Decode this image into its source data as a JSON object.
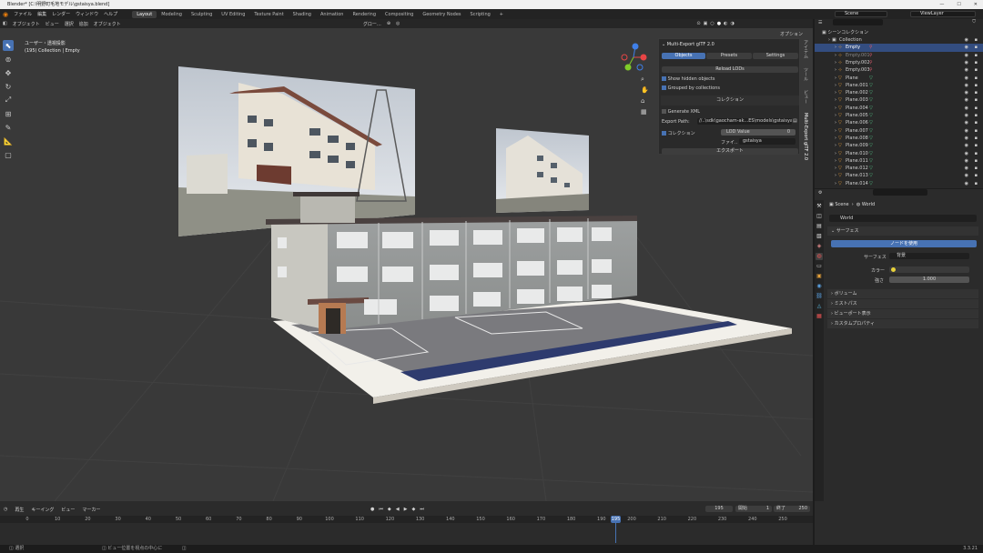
{
  "window": {
    "title": "Blender* [C:\\明野町毛地モデル\\gstaisya.blend]",
    "controls": [
      "—",
      "☐",
      "✕"
    ]
  },
  "topbar": {
    "menus": [
      "ファイル",
      "編集",
      "レンダー",
      "ウィンドウ",
      "ヘルプ"
    ],
    "workspaces": [
      "Layout",
      "Modeling",
      "Sculpting",
      "UV Editing",
      "Texture Paint",
      "Shading",
      "Animation",
      "Rendering",
      "Compositing",
      "Geometry Nodes",
      "Scripting"
    ],
    "active_workspace": "Layout",
    "scene": "Scene",
    "view_layer": "ViewLayer"
  },
  "viewport_header": {
    "items": [
      "オブジェクト",
      "ビュー",
      "選択",
      "追加",
      "オブジェクト"
    ],
    "orientation": "グロー…",
    "options_label": "オプション"
  },
  "viewport_info": {
    "line1": "ユーザー・透視投影",
    "line2": "(195) Collection | Empty"
  },
  "gizmo": {
    "x": "X",
    "y": "Y",
    "z": "Z"
  },
  "npanel": {
    "title": "Multi-Export glTF 2.0",
    "tabs": [
      "Objects",
      "Presets",
      "Settings"
    ],
    "active_tab": "Objects",
    "reload": "Reload LODs",
    "show_hidden": "Show hidden objects",
    "grouped": "Grouped by collections",
    "collection_section": "コレクション",
    "generate_xml": "Generate XML",
    "export_path_label": "Export Path:",
    "export_path": "//..\\sdk\\gaocham-ak...ES\\models\\gstaisyat",
    "collection_label": "コレクション",
    "lod_value": "LOD Value",
    "lod_num": "0",
    "file_label": "ファイ..",
    "file_value": "gstaisya",
    "export_button": "エクスポート"
  },
  "npanel_tabs": [
    "アイテム",
    "ツール",
    "ビュー",
    "Multi-Export glTF 2.0"
  ],
  "outliner": {
    "header_label": "シーンコレクション",
    "rows": [
      {
        "name": "Collection",
        "kind": "collection",
        "indent": 1,
        "selected": false
      },
      {
        "name": "Empty",
        "kind": "empty",
        "indent": 2,
        "selected": true
      },
      {
        "name": "Empty.001",
        "kind": "empty",
        "indent": 2,
        "selected": false,
        "dim": true
      },
      {
        "name": "Empty.002",
        "kind": "empty",
        "indent": 2,
        "selected": false
      },
      {
        "name": "Empty.003",
        "kind": "empty",
        "indent": 2,
        "selected": false
      },
      {
        "name": "Plane",
        "kind": "mesh",
        "indent": 2,
        "selected": false
      },
      {
        "name": "Plane.001",
        "kind": "mesh",
        "indent": 2,
        "selected": false
      },
      {
        "name": "Plane.002",
        "kind": "mesh",
        "indent": 2,
        "selected": false
      },
      {
        "name": "Plane.003",
        "kind": "mesh",
        "indent": 2,
        "selected": false
      },
      {
        "name": "Plane.004",
        "kind": "mesh",
        "indent": 2,
        "selected": false
      },
      {
        "name": "Plane.005",
        "kind": "mesh",
        "indent": 2,
        "selected": false
      },
      {
        "name": "Plane.006",
        "kind": "mesh",
        "indent": 2,
        "selected": false
      },
      {
        "name": "Plane.007",
        "kind": "mesh",
        "indent": 2,
        "selected": false
      },
      {
        "name": "Plane.008",
        "kind": "mesh",
        "indent": 2,
        "selected": false
      },
      {
        "name": "Plane.009",
        "kind": "mesh",
        "indent": 2,
        "selected": false
      },
      {
        "name": "Plane.010",
        "kind": "mesh",
        "indent": 2,
        "selected": false
      },
      {
        "name": "Plane.011",
        "kind": "mesh",
        "indent": 2,
        "selected": false
      },
      {
        "name": "Plane.012",
        "kind": "mesh",
        "indent": 2,
        "selected": false
      },
      {
        "name": "Plane.013",
        "kind": "mesh",
        "indent": 2,
        "selected": false
      },
      {
        "name": "Plane.014",
        "kind": "mesh",
        "indent": 2,
        "selected": false
      }
    ]
  },
  "properties": {
    "breadcrumb_scene": "Scene",
    "breadcrumb_world": "World",
    "world_name": "World",
    "surface_section": "サーフェス",
    "use_nodes": "ノードを使用",
    "surface_label": "サーフェス",
    "surface_value": "背景",
    "color_label": "カラー",
    "strength_label": "強さ",
    "strength_value": "1.000",
    "sections": [
      "ボリューム",
      "ミストパス",
      "ビューポート表示",
      "カスタムプロパティ"
    ]
  },
  "timeline": {
    "menus": [
      "再生",
      "キーイング",
      "ビュー",
      "マーカー"
    ],
    "current_frame": "195",
    "start_label": "開始",
    "start": "1",
    "end_label": "終了",
    "end": "250",
    "ticks": [
      "0",
      "10",
      "20",
      "30",
      "40",
      "50",
      "60",
      "70",
      "80",
      "90",
      "100",
      "110",
      "120",
      "130",
      "140",
      "150",
      "160",
      "170",
      "180",
      "190",
      "200",
      "210",
      "220",
      "230",
      "240",
      "250"
    ]
  },
  "statusbar": {
    "left": "選択",
    "middle": "ビュー位置を視点の中心に",
    "version": "3.3.21"
  },
  "colors": {
    "accent": "#4772b3",
    "selected_row": "#334d80",
    "mesh_icon": "#e59a35",
    "vertex_green": "#55c98a",
    "x_axis": "#e84545",
    "y_axis": "#7fcc29",
    "z_axis": "#3f7fe8"
  }
}
